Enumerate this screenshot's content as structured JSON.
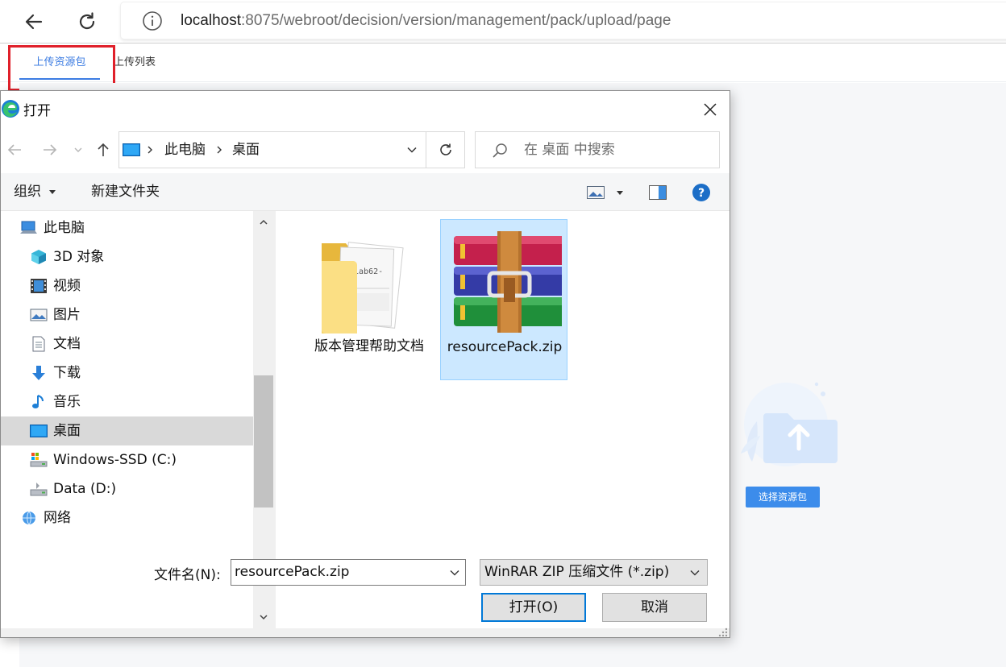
{
  "browser": {
    "url_host": "localhost",
    "url_rest": ":8075/webroot/decision/version/management/pack/upload/page"
  },
  "page": {
    "tabs": [
      {
        "label": "上传资源包",
        "active": true
      },
      {
        "label": "上传列表",
        "active": false
      }
    ],
    "choose_button": "选择资源包",
    "accent_color": "#3c7ce2"
  },
  "dialog": {
    "title": "打开",
    "breadcrumb": [
      "此电脑",
      "桌面"
    ],
    "search_placeholder": "在 桌面 中搜索",
    "toolbar": {
      "organize": "组织",
      "new_folder": "新建文件夹"
    },
    "tree": [
      {
        "label": "此电脑",
        "icon": "computer-icon",
        "indent": 1
      },
      {
        "label": "3D 对象",
        "icon": "cube-icon",
        "indent": 2
      },
      {
        "label": "视频",
        "icon": "film-icon",
        "indent": 2
      },
      {
        "label": "图片",
        "icon": "picture-icon",
        "indent": 2
      },
      {
        "label": "文档",
        "icon": "document-icon",
        "indent": 2
      },
      {
        "label": "下载",
        "icon": "download-icon",
        "indent": 2
      },
      {
        "label": "音乐",
        "icon": "music-icon",
        "indent": 2
      },
      {
        "label": "桌面",
        "icon": "desktop-icon",
        "indent": 2,
        "selected": true
      },
      {
        "label": "Windows-SSD (C:)",
        "icon": "drive-c-icon",
        "indent": 2
      },
      {
        "label": "Data (D:)",
        "icon": "drive-icon",
        "indent": 2
      },
      {
        "label": "网络",
        "icon": "network-icon",
        "indent": 1
      }
    ],
    "files": [
      {
        "name": "版本管理帮助文档",
        "type": "folder",
        "thumb_text": "081ab62-",
        "selected": false
      },
      {
        "name": "resourcePack.zip",
        "type": "winrar-zip",
        "selected": true
      }
    ],
    "filename_label": "文件名(N):",
    "filename_value": "resourcePack.zip",
    "filetype_value": "WinRAR ZIP 压缩文件 (*.zip)",
    "open_button": "打开(O)",
    "cancel_button": "取消"
  }
}
